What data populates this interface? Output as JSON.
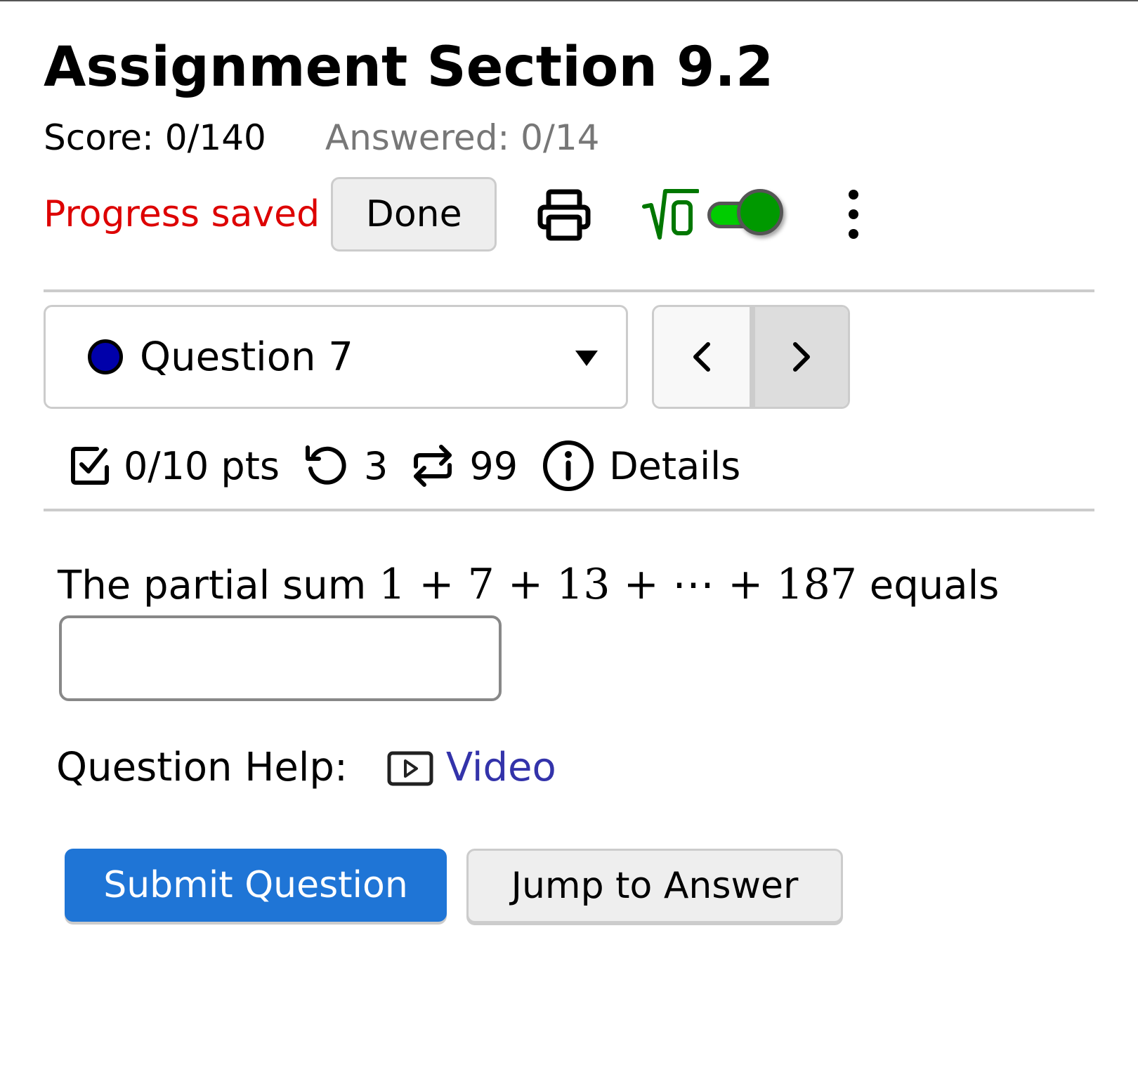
{
  "header": {
    "title": "Assignment Section 9.2",
    "score_label": "Score: 0/140",
    "answered_label": "Answered: 0/14"
  },
  "toolbar": {
    "status_text": "Progress saved",
    "done_label": "Done",
    "print_icon": "printer-icon",
    "math_icon": "sqrt-zero-icon",
    "math_toggle_on": true,
    "more_icon": "vertical-ellipsis-icon"
  },
  "colors": {
    "status_red": "#dd0000",
    "toggle_green": "#00cc00",
    "toggle_knob": "#009900",
    "question_dot": "#0000aa",
    "submit_blue": "#1f75d6",
    "link_blue": "#3333aa",
    "answered_gray": "#777777"
  },
  "question_nav": {
    "selected": "Question 7",
    "status": "unanswered",
    "prev_icon": "chevron-left-icon",
    "next_icon": "chevron-right-icon"
  },
  "question_meta": {
    "points": "0/10 pts",
    "attempts_remaining": "3",
    "versions": "99",
    "details_label": "Details"
  },
  "question": {
    "prompt_prefix": "The partial sum ",
    "prompt_math": "1 + 7 + 13 + ⋯ + 187",
    "prompt_suffix": " equals",
    "answer_value": "",
    "answer_placeholder": ""
  },
  "help": {
    "label": "Question Help:",
    "video_label": "Video"
  },
  "actions": {
    "submit_label": "Submit Question",
    "jump_label": "Jump to Answer"
  }
}
